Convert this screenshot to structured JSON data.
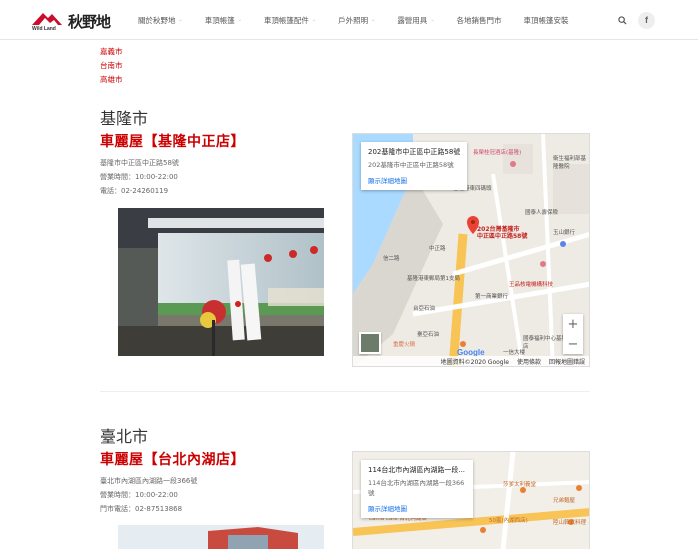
{
  "brand": {
    "name": "秋野地",
    "sub": "Wild Land"
  },
  "nav": {
    "items": [
      {
        "label": "關於秋野地",
        "has_dropdown": true
      },
      {
        "label": "車頂帳篷",
        "has_dropdown": true
      },
      {
        "label": "車頂帳篷配件",
        "has_dropdown": true
      },
      {
        "label": "戶外照明",
        "has_dropdown": true
      },
      {
        "label": "露營用具",
        "has_dropdown": true
      },
      {
        "label": "各地銷售門市",
        "has_dropdown": false
      },
      {
        "label": "車頂帳篷安裝",
        "has_dropdown": false
      }
    ]
  },
  "city_links": [
    "嘉義市",
    "台南市",
    "高雄市"
  ],
  "sections": [
    {
      "city": "基隆市",
      "store_name": "車麗屋【基隆中正店】",
      "address": "基隆市中正區中正路58號",
      "hours": "營業時間：10:00-22:00",
      "phone": "電話：02-24260119",
      "map": {
        "card_title": "202基隆市中正區中正路58號",
        "card_address": "202基隆市中正區中正路58號",
        "card_link": "顯示詳細地圖",
        "pin_label": "202台灣基隆市\n中正區中正路58號",
        "footer": [
          "地圖資料©2020 Google",
          "使用條款",
          "回報地圖錯誤"
        ],
        "places": [
          "長榮桂冠酒店(基隆)",
          "衛生福利部基隆醫院",
          "基隆港東四碼頭",
          "國泰人壽保險",
          "玉山銀行",
          "基隆港東郵局第1支局",
          "王品核電機構科技",
          "第一商業銀行",
          "台亞石油",
          "臺亞石油",
          "國泰福利中心基隆義二店",
          "重慶火鍋",
          "中正路",
          "信二路",
          "一信大樓"
        ]
      }
    },
    {
      "city": "臺北市",
      "store_name": "車麗屋【台北內湖店】",
      "address": "臺北市內湖區內湖路一段366號",
      "hours": "營業時間：10:00-22:00",
      "phone": "門市電話：02-87513868",
      "map": {
        "card_title": "114台北市內湖區內湖路一段...",
        "card_address": "114台北市內湖區內湖路一段366號",
        "card_link": "顯示詳細地圖",
        "places": [
          "莎爹太利義堂",
          "兄弟麵屋",
          "cama café 台北內湖店",
          "50嵐(內湖西店)",
          "陸山韓式料理"
        ]
      }
    }
  ],
  "colors": {
    "accent_red": "#cc0000",
    "link_blue": "#1a73e8"
  }
}
